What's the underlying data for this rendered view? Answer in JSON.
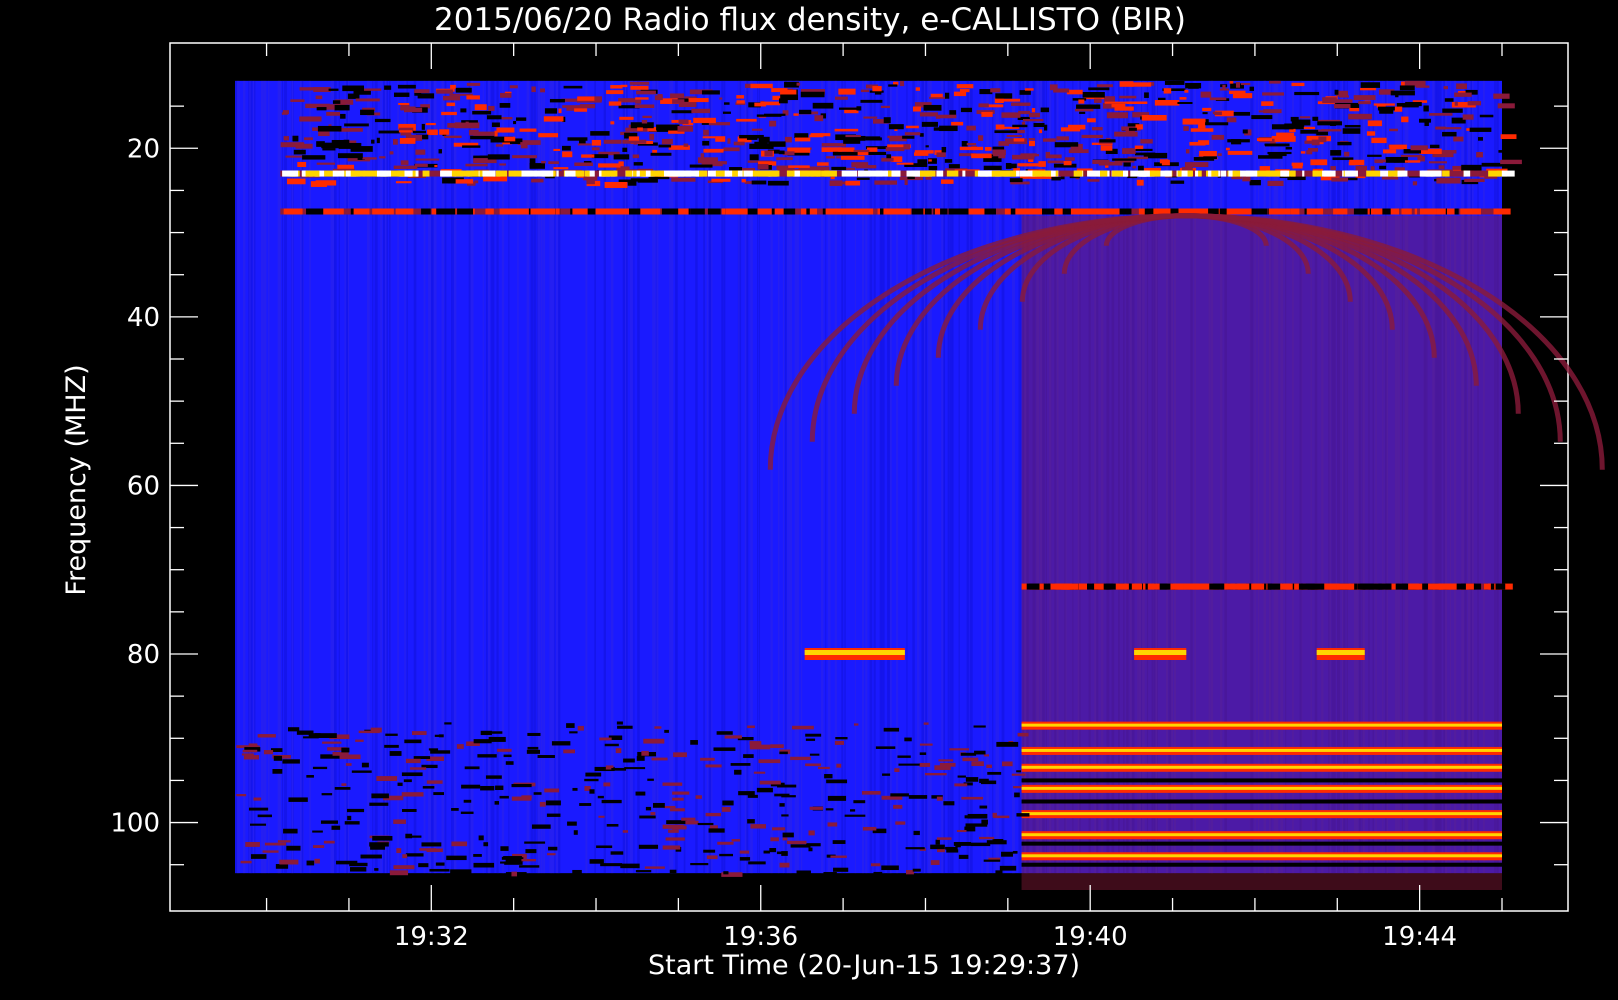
{
  "chart_data": {
    "type": "heatmap",
    "title": "2015/06/20  Radio flux density, e-CALLISTO (BIR)",
    "xlabel": "Start Time (20-Jun-15 19:29:37)",
    "ylabel": "Frequency (MHZ)",
    "x_unit": "HH:MM UT",
    "xlim": [
      "19:29:37",
      "19:45:00"
    ],
    "ylim": [
      10,
      108
    ],
    "y_inverted": true,
    "x_ticks": [
      "19:32",
      "19:36",
      "19:40",
      "19:44"
    ],
    "y_ticks": [
      20,
      40,
      60,
      80,
      100
    ],
    "data_extent": {
      "time": [
        "19:29:37",
        "19:45:00"
      ],
      "frequency_mhz": [
        12,
        106
      ]
    },
    "colormap": [
      "#000000",
      "#1a1aff",
      "#8a1a3a",
      "#ff2a00",
      "#ffd500",
      "#ffffff"
    ],
    "features": [
      {
        "kind": "rfi_band",
        "frequency_mhz": [
          12,
          24
        ],
        "time": [
          "19:30:10",
          "19:45:00"
        ],
        "level": "high"
      },
      {
        "kind": "rfi_line",
        "frequency_mhz": 23,
        "time": [
          "19:30:10",
          "19:45:00"
        ],
        "level": "max"
      },
      {
        "kind": "rfi_line",
        "frequency_mhz": 27.5,
        "time": [
          "19:30:10",
          "19:45:00"
        ],
        "level": "high"
      },
      {
        "kind": "diffuse_emission",
        "frequency_mhz": [
          28,
          108
        ],
        "time": [
          "19:39:10",
          "19:45:00"
        ],
        "level": "moderate"
      },
      {
        "kind": "rfi_line",
        "frequency_mhz": 72,
        "time": [
          "19:39:10",
          "19:45:00"
        ],
        "level": "high"
      },
      {
        "kind": "rfi_burst",
        "frequency_mhz": 80,
        "time": [
          "19:36:32",
          "19:37:45"
        ],
        "level": "max"
      },
      {
        "kind": "rfi_burst",
        "frequency_mhz": 80,
        "time": [
          "19:40:32",
          "19:41:10"
        ],
        "level": "max"
      },
      {
        "kind": "rfi_burst",
        "frequency_mhz": 80,
        "time": [
          "19:42:45",
          "19:43:20"
        ],
        "level": "max"
      },
      {
        "kind": "fm_band",
        "frequency_mhz": [
          88,
          106
        ],
        "time": [
          "19:39:10",
          "19:45:00"
        ],
        "level": "max"
      }
    ],
    "colors": {
      "background": "#000000",
      "axis": "#ffffff",
      "base": "#1a1aff"
    }
  }
}
